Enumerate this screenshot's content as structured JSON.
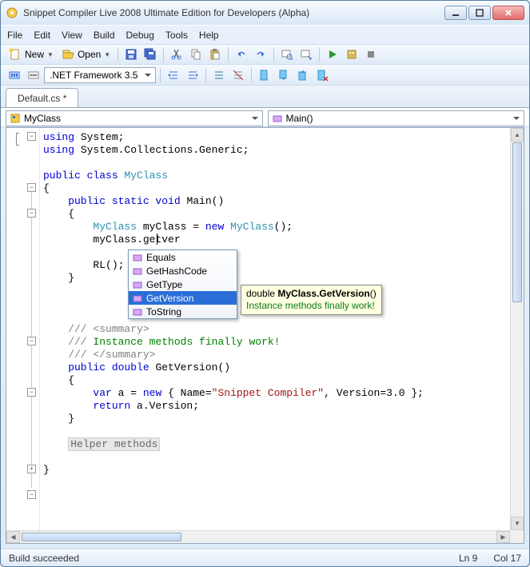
{
  "window": {
    "title": "Snippet Compiler Live 2008 Ultimate Edition for Developers (Alpha)"
  },
  "menus": [
    "File",
    "Edit",
    "View",
    "Build",
    "Debug",
    "Tools",
    "Help"
  ],
  "toolbar": {
    "new": "New",
    "open": "Open",
    "framework": ".NET Framework 3.5"
  },
  "tab": {
    "label": "Default.cs *"
  },
  "nav": {
    "class": "MyClass",
    "member": "Main()"
  },
  "code": {
    "l1a": "using",
    "l1b": " System;",
    "l2a": "using",
    "l2b": " System.Collections.Generic;",
    "l4a": "public class ",
    "l4b": "MyClass",
    "l5": "{",
    "l6a": "    public static void ",
    "l6b": "Main()",
    "l7": "    {",
    "l8a": "        MyClass",
    "l8b": " myClass = ",
    "l8c": "new ",
    "l8d": "MyClass",
    "l8e": "();",
    "l9": "        myClass.getver",
    "l11": "        RL();",
    "l12": "    }",
    "l15a": "    /// ",
    "l15b": "<summary>",
    "l16a": "    /// ",
    "l16b": "Instance methods finally work!",
    "l17a": "    /// ",
    "l17b": "</summary>",
    "l18a": "    public double ",
    "l18b": "GetVersion()",
    "l19": "    {",
    "l20a": "        var",
    "l20b": " a = ",
    "l20c": "new",
    "l20d": " { Name=",
    "l20e": "\"Snippet Compiler\"",
    "l20f": ", Version=3.0 };",
    "l21a": "        return",
    "l21b": " a.Version;",
    "l22": "    }",
    "region": "Helper methods"
  },
  "intellisense": {
    "items": [
      "Equals",
      "GetHashCode",
      "GetType",
      "GetVersion",
      "ToString"
    ],
    "selected": 3
  },
  "tooltip": {
    "sig_pre": "double ",
    "sig_bold": "MyClass.GetVersion",
    "sig_post": "()",
    "desc": "Instance methods finally work!"
  },
  "status": {
    "msg": "Build succeeded",
    "ln": "Ln 9",
    "col": "Col 17"
  }
}
